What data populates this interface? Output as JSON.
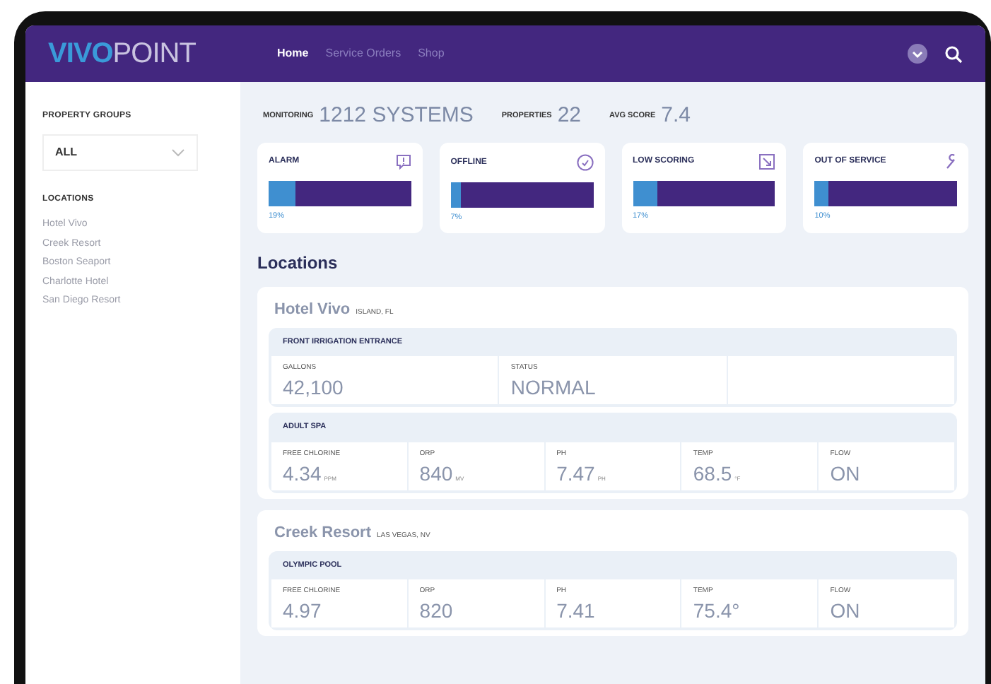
{
  "header": {
    "logo_bold": "VIVO",
    "logo_light": "POINT",
    "nav": [
      {
        "label": "Home",
        "selected": true
      },
      {
        "label": "Service Orders",
        "selected": false
      },
      {
        "label": "Shop",
        "selected": false
      }
    ]
  },
  "sidebar": {
    "groups_label": "PROPERTY GROUPS",
    "group_select": "ALL",
    "locations_label": "LOCATIONS",
    "locations": [
      "Hotel Vivo",
      "Creek Resort",
      "Boston Seaport",
      "Charlotte Hotel",
      "San Diego Resort"
    ]
  },
  "summary": [
    {
      "label": "MONITORING",
      "value": "1212 SYSTEMS"
    },
    {
      "label": "PROPERTIES",
      "value": "22"
    },
    {
      "label": "AVG SCORE",
      "value": "7.4"
    }
  ],
  "status_cards": [
    {
      "label": "ALARM",
      "level": 0.19,
      "reading": "19%"
    },
    {
      "label": "OFFLINE",
      "level": 0.07,
      "reading": "7%"
    },
    {
      "label": "LOW SCORING",
      "level": 0.17,
      "reading": "17%"
    },
    {
      "label": "OUT OF SERVICE",
      "level": 0.1,
      "reading": "10%"
    }
  ],
  "locations_title": "Locations",
  "locations": [
    {
      "name": "Hotel Vivo",
      "place": "ISLAND, FL",
      "systems": [
        {
          "name": "FRONT IRRIGATION ENTRANCE",
          "readings": [
            {
              "label": "GALLONS",
              "value": "42,100"
            },
            {
              "label": "STATUS",
              "value": "NORMAL"
            }
          ]
        },
        {
          "name": "ADULT SPA",
          "readings": [
            {
              "label": "FREE CHLORINE",
              "value": "4.34",
              "unit": "PPM"
            },
            {
              "label": "ORP",
              "value": "840",
              "unit": "MV"
            },
            {
              "label": "PH",
              "value": "7.47",
              "unit": "PH"
            },
            {
              "label": "TEMP",
              "value": "68.5",
              "unit": "°F"
            },
            {
              "label": "FLOW",
              "value": "ON"
            }
          ]
        }
      ]
    },
    {
      "name": "Creek Resort",
      "place": "LAS VEGAS, NV",
      "systems": [
        {
          "name": "OLYMPIC POOL",
          "readings": [
            {
              "label": "FREE CHLORINE",
              "value": "4.97"
            },
            {
              "label": "ORP",
              "value": "820"
            },
            {
              "label": "PH",
              "value": "7.41"
            },
            {
              "label": "TEMP",
              "value": "75.4°"
            },
            {
              "label": "FLOW",
              "value": "ON"
            }
          ]
        }
      ]
    }
  ]
}
